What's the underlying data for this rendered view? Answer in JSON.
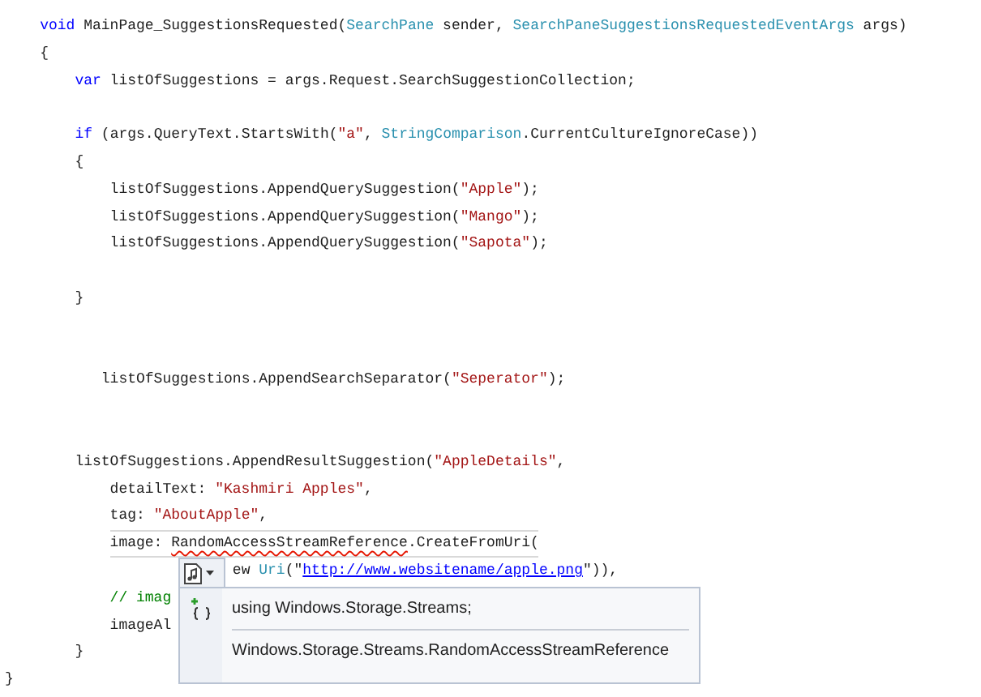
{
  "editor": {
    "lines": [
      {
        "kind": "code",
        "tokens": [
          {
            "kind": "keyword",
            "text": "    void"
          },
          {
            "kind": "plain",
            "text": " MainPage_SuggestionsRequested("
          },
          {
            "kind": "type",
            "text": "SearchPane"
          },
          {
            "kind": "plain",
            "text": " sender, "
          },
          {
            "kind": "type",
            "text": "SearchPaneSuggestionsRequestedEventArgs"
          },
          {
            "kind": "plain",
            "text": " args)"
          }
        ]
      },
      {
        "kind": "code",
        "tokens": [
          {
            "kind": "plain",
            "text": "    {"
          }
        ]
      },
      {
        "kind": "code",
        "tokens": [
          {
            "kind": "keyword",
            "text": "        var"
          },
          {
            "kind": "plain",
            "text": " listOfSuggestions = args.Request.SearchSuggestionCollection;"
          }
        ]
      },
      {
        "kind": "blank"
      },
      {
        "kind": "code",
        "tokens": [
          {
            "kind": "keyword",
            "text": "        if"
          },
          {
            "kind": "plain",
            "text": " (args.QueryText.StartsWith("
          },
          {
            "kind": "string",
            "text": "\"a\""
          },
          {
            "kind": "plain",
            "text": ", "
          },
          {
            "kind": "type",
            "text": "StringComparison"
          },
          {
            "kind": "plain",
            "text": ".CurrentCultureIgnoreCase))"
          }
        ]
      },
      {
        "kind": "code",
        "tokens": [
          {
            "kind": "plain",
            "text": "        {"
          }
        ]
      },
      {
        "kind": "code",
        "tokens": [
          {
            "kind": "plain",
            "text": "            listOfSuggestions.AppendQuerySuggestion("
          },
          {
            "kind": "string",
            "text": "\"Apple\""
          },
          {
            "kind": "plain",
            "text": ");"
          }
        ]
      },
      {
        "kind": "code",
        "tokens": [
          {
            "kind": "plain",
            "text": "            listOfSuggestions.AppendQuerySuggestion("
          },
          {
            "kind": "string",
            "text": "\"Mango\""
          },
          {
            "kind": "plain",
            "text": ");"
          }
        ]
      },
      {
        "kind": "code",
        "tokens": [
          {
            "kind": "plain",
            "text": "            listOfSuggestions.AppendQuerySuggestion("
          },
          {
            "kind": "string",
            "text": "\"Sapota\""
          },
          {
            "kind": "plain",
            "text": ");"
          }
        ]
      },
      {
        "kind": "blank"
      },
      {
        "kind": "code",
        "tokens": [
          {
            "kind": "plain",
            "text": "        }"
          }
        ]
      },
      {
        "kind": "blank"
      },
      {
        "kind": "blank"
      },
      {
        "kind": "code",
        "tokens": [
          {
            "kind": "plain",
            "text": "           listOfSuggestions.AppendSearchSeparator("
          },
          {
            "kind": "string",
            "text": "\"Seperator\""
          },
          {
            "kind": "plain",
            "text": ");"
          }
        ]
      },
      {
        "kind": "blank"
      },
      {
        "kind": "blank"
      },
      {
        "kind": "code",
        "tokens": [
          {
            "kind": "plain",
            "text": "        listOfSuggestions.AppendResultSuggestion("
          },
          {
            "kind": "string",
            "text": "\"AppleDetails\""
          },
          {
            "kind": "plain",
            "text": ","
          }
        ]
      },
      {
        "kind": "code",
        "tokens": [
          {
            "kind": "plain",
            "text": "            detailText: "
          },
          {
            "kind": "string",
            "text": "\"Kashmiri Apples\""
          },
          {
            "kind": "plain",
            "text": ","
          }
        ]
      },
      {
        "kind": "code",
        "tokens": [
          {
            "kind": "plain",
            "text": "            tag: "
          },
          {
            "kind": "string",
            "text": "\"AboutApple\""
          },
          {
            "kind": "plain",
            "text": ","
          }
        ]
      },
      {
        "kind": "code",
        "current": true,
        "tokens": [
          {
            "kind": "plain",
            "text": "            image: "
          },
          {
            "kind": "error",
            "text": "RandomAccessStreamReference"
          },
          {
            "kind": "plain",
            "text": ".CreateFromUri("
          }
        ]
      },
      {
        "kind": "code",
        "tokens": [
          {
            "kind": "plain",
            "text": "                          ew "
          },
          {
            "kind": "type",
            "text": "Uri"
          },
          {
            "kind": "plain",
            "text": "(\""
          },
          {
            "kind": "link",
            "text": "http://www.websitename/apple.png"
          },
          {
            "kind": "plain",
            "text": "\")),"
          }
        ]
      },
      {
        "kind": "code",
        "tokens": [
          {
            "kind": "comment",
            "text": "            // imag"
          }
        ]
      },
      {
        "kind": "code",
        "tokens": [
          {
            "kind": "plain",
            "text": "            imageAl"
          }
        ]
      },
      {
        "kind": "code",
        "tokens": [
          {
            "kind": "plain",
            "text": "        }"
          }
        ]
      },
      {
        "kind": "code",
        "tokens": [
          {
            "kind": "plain",
            "text": "}"
          }
        ]
      }
    ]
  },
  "quick_actions": {
    "items": [
      "using Windows.Storage.Streams;",
      "Windows.Storage.Streams.RandomAccessStreamReference"
    ]
  }
}
